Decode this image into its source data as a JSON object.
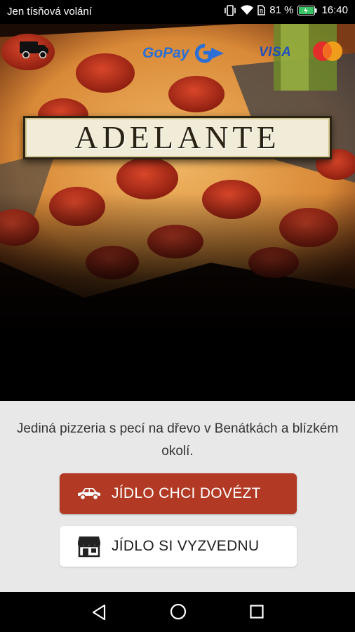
{
  "status_bar": {
    "carrier": "Jen tísňová volání",
    "battery_percent": "81 %",
    "time": "16:40"
  },
  "hero": {
    "logo_text": "ADELANTE",
    "payments": {
      "gopay_label": "GoPay",
      "visa_label": "VISA"
    }
  },
  "panel": {
    "tagline": "Jediná pizzeria s pecí na dřevo v Benátkách a blízkém okolí.",
    "deliver_button": "JÍDLO CHCI DOVÉZT",
    "pickup_button": "JÍDLO SI VYZVEDNU"
  },
  "colors": {
    "accent": "#b23a25",
    "panel_bg": "#e8e8e8"
  },
  "icons": [
    "truck-icon",
    "gopay-logo",
    "visa-logo",
    "mastercard-logo",
    "car-icon",
    "shop-icon",
    "back-icon",
    "home-icon",
    "recent-apps-icon"
  ]
}
